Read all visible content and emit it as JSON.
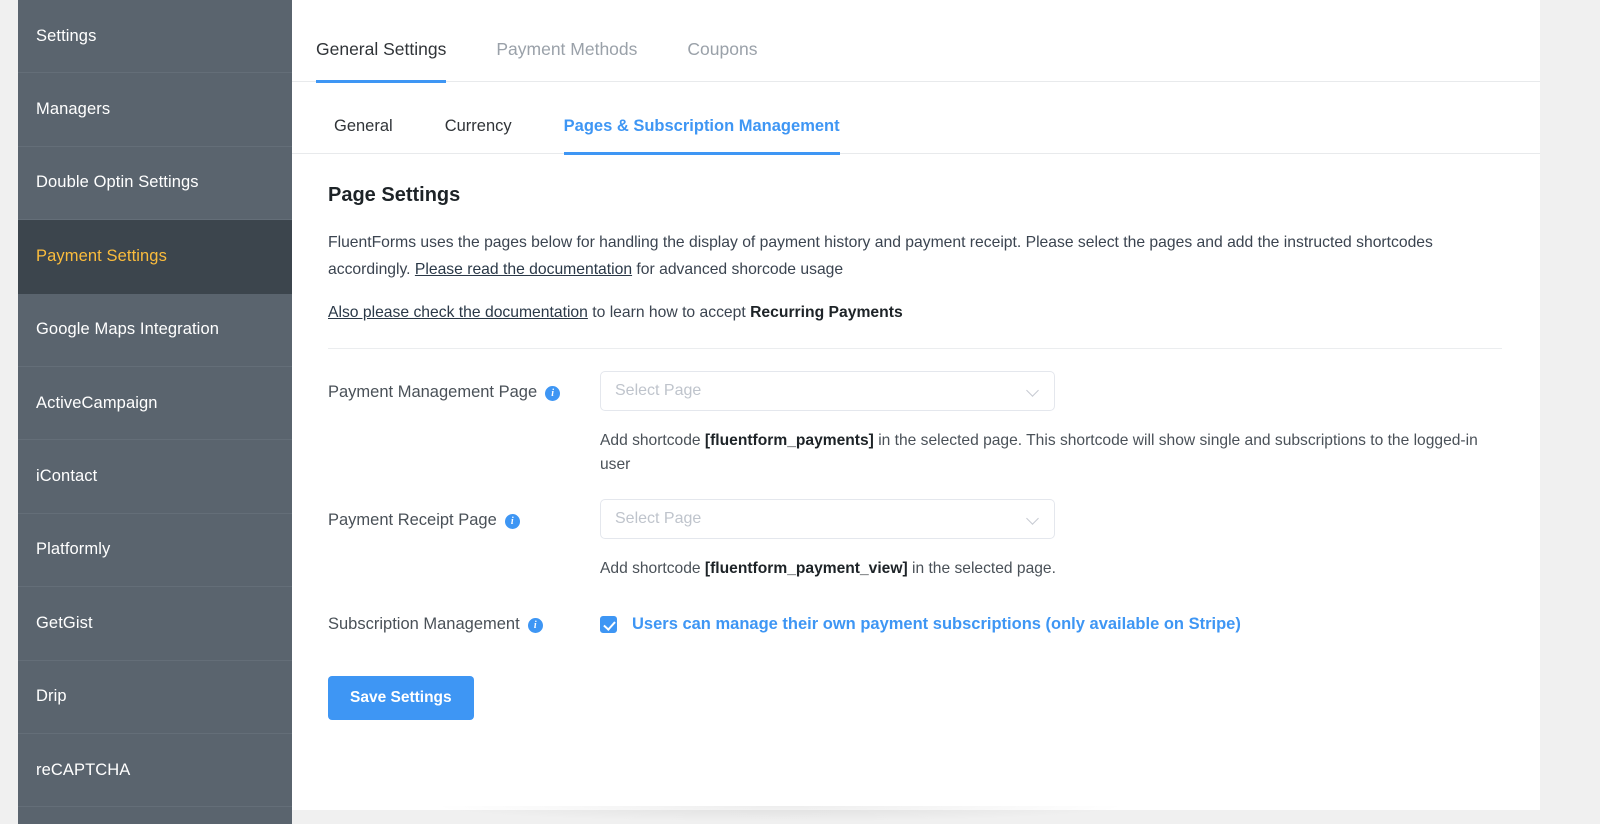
{
  "sidebar": {
    "items": [
      {
        "label": "Settings",
        "active": false
      },
      {
        "label": "Managers",
        "active": false
      },
      {
        "label": "Double Optin Settings",
        "active": false
      },
      {
        "label": "Payment Settings",
        "active": true
      },
      {
        "label": "Google Maps Integration",
        "active": false
      },
      {
        "label": "ActiveCampaign",
        "active": false
      },
      {
        "label": "iContact",
        "active": false
      },
      {
        "label": "Platformly",
        "active": false
      },
      {
        "label": "GetGist",
        "active": false
      },
      {
        "label": "Drip",
        "active": false
      },
      {
        "label": "reCAPTCHA",
        "active": false
      }
    ]
  },
  "main_tabs": [
    {
      "label": "General Settings",
      "active": true
    },
    {
      "label": "Payment Methods",
      "active": false
    },
    {
      "label": "Coupons",
      "active": false
    }
  ],
  "sub_tabs": [
    {
      "label": "General",
      "active": false
    },
    {
      "label": "Currency",
      "active": false
    },
    {
      "label": "Pages & Subscription Management",
      "active": true
    }
  ],
  "page": {
    "title": "Page Settings",
    "desc_part1": "FluentForms uses the pages below for handling the display of payment history and payment receipt. Please select the pages and add the instructed shortcodes accordingly. ",
    "desc_link1": "Please read the documentation",
    "desc_part2": " for advanced shorcode usage",
    "desc2_link": "Also please check the documentation",
    "desc2_part1": " to learn how to accept ",
    "desc2_bold": "Recurring Payments"
  },
  "fields": {
    "management": {
      "label": "Payment Management Page",
      "info_icon": "info-icon",
      "select_placeholder": "Select Page",
      "select_value": "",
      "help_pre": "Add shortcode ",
      "help_code": "[fluentform_payments]",
      "help_post": " in the selected page. This shortcode will show single and subscriptions to the logged-in user"
    },
    "receipt": {
      "label": "Payment Receipt Page",
      "info_icon": "info-icon",
      "select_placeholder": "Select Page",
      "select_value": "",
      "help_pre": "Add shortcode ",
      "help_code": "[fluentform_payment_view]",
      "help_post": " in the selected page."
    },
    "subscription": {
      "label": "Subscription Management",
      "info_icon": "info-icon",
      "checkbox_checked": true,
      "checkbox_label": "Users can manage their own payment subscriptions (only available on Stripe)"
    }
  },
  "actions": {
    "save_label": "Save Settings"
  },
  "colors": {
    "accent": "#3e96f4",
    "sidebar_bg": "#5a646e",
    "sidebar_active_bg": "#3c454d",
    "sidebar_active_text": "#fbbc3c",
    "page_bg": "#f0f0f0"
  }
}
